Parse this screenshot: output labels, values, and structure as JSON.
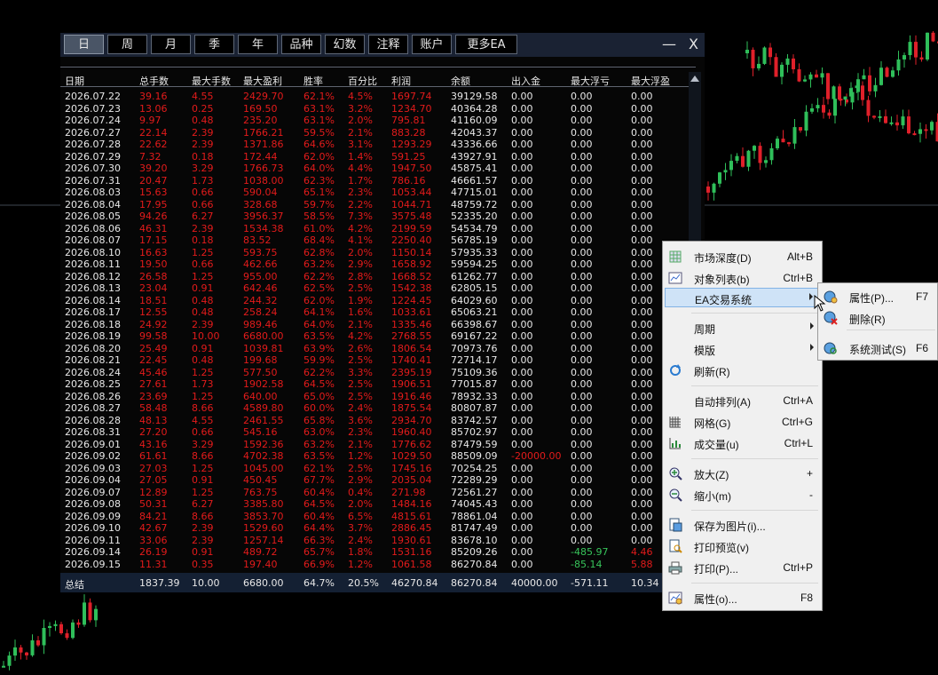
{
  "tabs": [
    {
      "label": "日",
      "active": true
    },
    {
      "label": "周"
    },
    {
      "label": "月"
    },
    {
      "label": "季"
    },
    {
      "label": "年"
    },
    {
      "label": "品种"
    },
    {
      "label": "幻数"
    },
    {
      "label": "注释"
    },
    {
      "label": "账户"
    },
    {
      "label": "更多EA"
    }
  ],
  "window": {
    "minimize": "—",
    "close": "X"
  },
  "table": {
    "columns": [
      "日期",
      "总手数",
      "最大手数",
      "最大盈利",
      "胜率",
      "百分比",
      "利润",
      "余额",
      "出入金",
      "最大浮亏",
      "最大浮盈"
    ],
    "rows": [
      [
        "2026.07.22",
        "39.16",
        "4.55",
        "2429.70",
        "62.1%",
        "4.5%",
        "1697.74",
        "39129.58",
        "0.00",
        "0.00",
        "0.00"
      ],
      [
        "2026.07.23",
        "13.06",
        "0.25",
        "169.50",
        "63.1%",
        "3.2%",
        "1234.70",
        "40364.28",
        "0.00",
        "0.00",
        "0.00"
      ],
      [
        "2026.07.24",
        "9.97",
        "0.48",
        "235.20",
        "63.1%",
        "2.0%",
        "795.81",
        "41160.09",
        "0.00",
        "0.00",
        "0.00"
      ],
      [
        "2026.07.27",
        "22.14",
        "2.39",
        "1766.21",
        "59.5%",
        "2.1%",
        "883.28",
        "42043.37",
        "0.00",
        "0.00",
        "0.00"
      ],
      [
        "2026.07.28",
        "22.62",
        "2.39",
        "1371.86",
        "64.6%",
        "3.1%",
        "1293.29",
        "43336.66",
        "0.00",
        "0.00",
        "0.00"
      ],
      [
        "2026.07.29",
        "7.32",
        "0.18",
        "172.44",
        "62.0%",
        "1.4%",
        "591.25",
        "43927.91",
        "0.00",
        "0.00",
        "0.00"
      ],
      [
        "2026.07.30",
        "39.20",
        "3.29",
        "1766.73",
        "64.0%",
        "4.4%",
        "1947.50",
        "45875.41",
        "0.00",
        "0.00",
        "0.00"
      ],
      [
        "2026.07.31",
        "20.47",
        "1.73",
        "1038.00",
        "62.3%",
        "1.7%",
        "786.16",
        "46661.57",
        "0.00",
        "0.00",
        "0.00"
      ],
      [
        "2026.08.03",
        "15.63",
        "0.66",
        "590.04",
        "65.1%",
        "2.3%",
        "1053.44",
        "47715.01",
        "0.00",
        "0.00",
        "0.00"
      ],
      [
        "2026.08.04",
        "17.95",
        "0.66",
        "328.68",
        "59.7%",
        "2.2%",
        "1044.71",
        "48759.72",
        "0.00",
        "0.00",
        "0.00"
      ],
      [
        "2026.08.05",
        "94.26",
        "6.27",
        "3956.37",
        "58.5%",
        "7.3%",
        "3575.48",
        "52335.20",
        "0.00",
        "0.00",
        "0.00"
      ],
      [
        "2026.08.06",
        "46.31",
        "2.39",
        "1534.38",
        "61.0%",
        "4.2%",
        "2199.59",
        "54534.79",
        "0.00",
        "0.00",
        "0.00"
      ],
      [
        "2026.08.07",
        "17.15",
        "0.18",
        "83.52",
        "68.4%",
        "4.1%",
        "2250.40",
        "56785.19",
        "0.00",
        "0.00",
        "0.00"
      ],
      [
        "2026.08.10",
        "16.63",
        "1.25",
        "593.75",
        "62.8%",
        "2.0%",
        "1150.14",
        "57935.33",
        "0.00",
        "0.00",
        "0.00"
      ],
      [
        "2026.08.11",
        "19.50",
        "0.66",
        "462.66",
        "63.2%",
        "2.9%",
        "1658.92",
        "59594.25",
        "0.00",
        "0.00",
        "0.00"
      ],
      [
        "2026.08.12",
        "26.58",
        "1.25",
        "955.00",
        "62.2%",
        "2.8%",
        "1668.52",
        "61262.77",
        "0.00",
        "0.00",
        "0.00"
      ],
      [
        "2026.08.13",
        "23.04",
        "0.91",
        "642.46",
        "62.5%",
        "2.5%",
        "1542.38",
        "62805.15",
        "0.00",
        "0.00",
        "0.00"
      ],
      [
        "2026.08.14",
        "18.51",
        "0.48",
        "244.32",
        "62.0%",
        "1.9%",
        "1224.45",
        "64029.60",
        "0.00",
        "0.00",
        "0.00"
      ],
      [
        "2026.08.17",
        "12.55",
        "0.48",
        "258.24",
        "64.1%",
        "1.6%",
        "1033.61",
        "65063.21",
        "0.00",
        "0.00",
        "0.00"
      ],
      [
        "2026.08.18",
        "24.92",
        "2.39",
        "989.46",
        "64.0%",
        "2.1%",
        "1335.46",
        "66398.67",
        "0.00",
        "0.00",
        "0.00"
      ],
      [
        "2026.08.19",
        "99.58",
        "10.00",
        "6680.00",
        "63.5%",
        "4.2%",
        "2768.55",
        "69167.22",
        "0.00",
        "0.00",
        "0.00"
      ],
      [
        "2026.08.20",
        "25.49",
        "0.91",
        "1039.81",
        "63.9%",
        "2.6%",
        "1806.54",
        "70973.76",
        "0.00",
        "0.00",
        "0.00"
      ],
      [
        "2026.08.21",
        "22.45",
        "0.48",
        "199.68",
        "59.9%",
        "2.5%",
        "1740.41",
        "72714.17",
        "0.00",
        "0.00",
        "0.00"
      ],
      [
        "2026.08.24",
        "45.46",
        "1.25",
        "577.50",
        "62.2%",
        "3.3%",
        "2395.19",
        "75109.36",
        "0.00",
        "0.00",
        "0.00"
      ],
      [
        "2026.08.25",
        "27.61",
        "1.73",
        "1902.58",
        "64.5%",
        "2.5%",
        "1906.51",
        "77015.87",
        "0.00",
        "0.00",
        "0.00"
      ],
      [
        "2026.08.26",
        "23.69",
        "1.25",
        "640.00",
        "65.0%",
        "2.5%",
        "1916.46",
        "78932.33",
        "0.00",
        "0.00",
        "0.00"
      ],
      [
        "2026.08.27",
        "58.48",
        "8.66",
        "4589.80",
        "60.0%",
        "2.4%",
        "1875.54",
        "80807.87",
        "0.00",
        "0.00",
        "0.00"
      ],
      [
        "2026.08.28",
        "48.13",
        "4.55",
        "2461.55",
        "65.8%",
        "3.6%",
        "2934.70",
        "83742.57",
        "0.00",
        "0.00",
        "0.00"
      ],
      [
        "2026.08.31",
        "27.20",
        "0.66",
        "545.16",
        "63.0%",
        "2.3%",
        "1960.40",
        "85702.97",
        "0.00",
        "0.00",
        "0.00"
      ],
      [
        "2026.09.01",
        "43.16",
        "3.29",
        "1592.36",
        "63.2%",
        "2.1%",
        "1776.62",
        "87479.59",
        "0.00",
        "0.00",
        "0.00"
      ],
      [
        "2026.09.02",
        "61.61",
        "8.66",
        "4702.38",
        "63.5%",
        "1.2%",
        "1029.50",
        "88509.09",
        "-20000.00",
        "0.00",
        "0.00"
      ],
      [
        "2026.09.03",
        "27.03",
        "1.25",
        "1045.00",
        "62.1%",
        "2.5%",
        "1745.16",
        "70254.25",
        "0.00",
        "0.00",
        "0.00"
      ],
      [
        "2026.09.04",
        "27.05",
        "0.91",
        "450.45",
        "67.7%",
        "2.9%",
        "2035.04",
        "72289.29",
        "0.00",
        "0.00",
        "0.00"
      ],
      [
        "2026.09.07",
        "12.89",
        "1.25",
        "763.75",
        "60.4%",
        "0.4%",
        "271.98",
        "72561.27",
        "0.00",
        "0.00",
        "0.00"
      ],
      [
        "2026.09.08",
        "50.31",
        "6.27",
        "3385.80",
        "64.5%",
        "2.0%",
        "1484.16",
        "74045.43",
        "0.00",
        "0.00",
        "0.00"
      ],
      [
        "2026.09.09",
        "84.21",
        "8.66",
        "3853.70",
        "60.4%",
        "6.5%",
        "4815.61",
        "78861.04",
        "0.00",
        "0.00",
        "0.00"
      ],
      [
        "2026.09.10",
        "42.67",
        "2.39",
        "1529.60",
        "64.4%",
        "3.7%",
        "2886.45",
        "81747.49",
        "0.00",
        "0.00",
        "0.00"
      ],
      [
        "2026.09.11",
        "33.06",
        "2.39",
        "1257.14",
        "66.3%",
        "2.4%",
        "1930.61",
        "83678.10",
        "0.00",
        "0.00",
        "0.00"
      ],
      [
        "2026.09.14",
        "26.19",
        "0.91",
        "489.72",
        "65.7%",
        "1.8%",
        "1531.16",
        "85209.26",
        "0.00",
        "-485.97",
        "4.46"
      ],
      [
        "2026.09.15",
        "11.31",
        "0.35",
        "197.40",
        "66.9%",
        "1.2%",
        "1061.58",
        "86270.84",
        "0.00",
        "-85.14",
        "5.88"
      ]
    ],
    "summary": [
      "总结",
      "1837.39",
      "10.00",
      "6680.00",
      "64.7%",
      "20.5%",
      "46270.84",
      "86270.84",
      "40000.00",
      "-571.11",
      "10.34"
    ]
  },
  "context_menu": {
    "items": [
      {
        "label": "市场深度(D)",
        "shortcut": "Alt+B",
        "icon": "market-depth-icon"
      },
      {
        "label": "对象列表(b)",
        "shortcut": "Ctrl+B",
        "icon": "object-list-icon"
      },
      {
        "label": "EA交易系统",
        "shortcut": "",
        "submenu": true,
        "highlight": true
      },
      {
        "label": "周期",
        "shortcut": "",
        "submenu": true
      },
      {
        "label": "模版",
        "shortcut": "",
        "submenu": true
      },
      {
        "label": "刷新(R)",
        "shortcut": "",
        "icon": "refresh-icon"
      },
      {
        "label": "自动排列(A)",
        "shortcut": "Ctrl+A"
      },
      {
        "label": "网格(G)",
        "shortcut": "Ctrl+G",
        "icon": "grid-icon"
      },
      {
        "label": "成交量(u)",
        "shortcut": "Ctrl+L",
        "icon": "volume-icon"
      },
      {
        "label": "放大(Z)",
        "shortcut": "+",
        "icon": "zoom-in-icon"
      },
      {
        "label": "缩小(m)",
        "shortcut": "-",
        "icon": "zoom-out-icon"
      },
      {
        "label": "保存为图片(i)...",
        "shortcut": "",
        "icon": "save-image-icon"
      },
      {
        "label": "打印预览(v)",
        "shortcut": "",
        "icon": "print-preview-icon"
      },
      {
        "label": "打印(P)...",
        "shortcut": "Ctrl+P",
        "icon": "print-icon"
      },
      {
        "label": "属性(o)...",
        "shortcut": "F8",
        "icon": "properties-icon"
      }
    ]
  },
  "submenu": {
    "items": [
      {
        "label": "属性(P)...",
        "shortcut": "F7",
        "icon": "ea-properties-icon"
      },
      {
        "label": "删除(R)",
        "shortcut": "",
        "icon": "ea-delete-icon"
      },
      {
        "label": "系统测试(S)",
        "shortcut": "F6",
        "icon": "ea-test-icon"
      }
    ]
  },
  "colors": {
    "profit": "#e31b1b",
    "loss": "#37c45a",
    "text": "#e8e8e8",
    "menu_highlight": "#cfe3f7"
  }
}
